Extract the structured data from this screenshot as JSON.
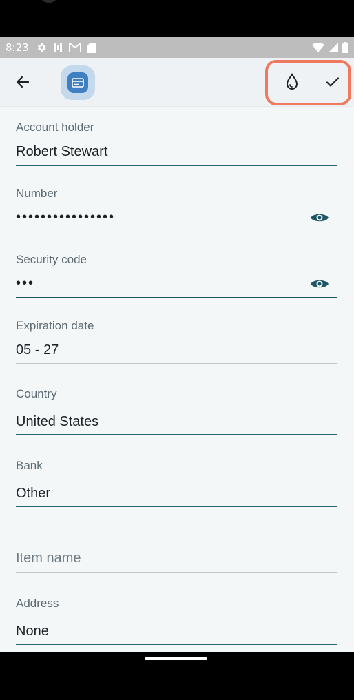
{
  "status_bar": {
    "time": "8:23",
    "left_icons": [
      "gear-icon",
      "data-icon",
      "gmail-icon",
      "sd-card-icon"
    ],
    "right_icons": [
      "wifi-icon",
      "signal-icon",
      "battery-icon"
    ]
  },
  "app_bar": {
    "back_icon": "arrow-back-icon",
    "item_type_icon": "credit-card-icon",
    "color_icon": "water-drop-icon",
    "save_icon": "checkmark-icon",
    "highlight_color": "#f07a5f"
  },
  "form": {
    "account_holder": {
      "label": "Account holder",
      "value": "Robert Stewart"
    },
    "number": {
      "label": "Number",
      "value": "••••••••••••••••"
    },
    "security_code": {
      "label": "Security code",
      "value": "•••"
    },
    "expiration_date": {
      "label": "Expiration date",
      "value": "05 - 27"
    },
    "country": {
      "label": "Country",
      "value": "United States"
    },
    "bank": {
      "label": "Bank",
      "value": "Other"
    },
    "item_name": {
      "placeholder": "Item name"
    },
    "address": {
      "label": "Address",
      "value": "None"
    }
  },
  "colors": {
    "accent": "#2a6776",
    "badge_bg": "#c5d9ec",
    "badge_fg": "#3f7fc2"
  }
}
